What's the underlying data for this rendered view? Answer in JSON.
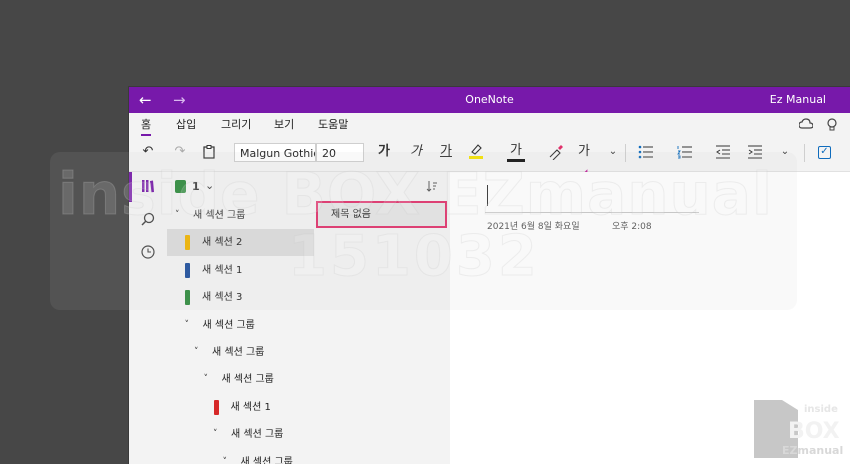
{
  "window": {
    "app_title": "OneNote",
    "user_name": "Ez Manual",
    "back_icon": "arrow-left-icon",
    "forward_icon": "arrow-right-icon"
  },
  "ribbon": {
    "tabs": [
      "홈",
      "삽입",
      "그리기",
      "보기",
      "도움말"
    ],
    "active_tab": "홈",
    "font_name": "Malgun Gothic",
    "font_size": "20",
    "bold_label": "가",
    "italic_label": "가",
    "underline_label": "가",
    "highlight_label": "가",
    "font_color_label": "가",
    "clear_format_label": "가",
    "tool_icons": [
      "undo-icon",
      "redo-icon",
      "clipboard-icon",
      "highlighter-icon",
      "format-painter-icon",
      "clear-formatting-icon",
      "bullets-icon",
      "numbering-icon",
      "outdent-icon",
      "indent-icon",
      "checkbox-icon"
    ],
    "accent_color": "#7719aa"
  },
  "notebook": {
    "name": "1",
    "icon_color": "#2e8b3d"
  },
  "sections": [
    {
      "label": "새 섹션 그룹",
      "type": "group",
      "indent": 0
    },
    {
      "label": "새 섹션 2",
      "type": "section",
      "color": "#f0b400",
      "indent": 0,
      "selected": true
    },
    {
      "label": "새 섹션 1",
      "type": "section",
      "color": "#1e4f9c",
      "indent": 0
    },
    {
      "label": "새 섹션 3",
      "type": "section",
      "color": "#2e8b3d",
      "indent": 0
    },
    {
      "label": "새 섹션 그룹",
      "type": "group",
      "indent": 1
    },
    {
      "label": "새 섹션 그룹",
      "type": "group",
      "indent": 2
    },
    {
      "label": "새 섹션 그룹",
      "type": "group",
      "indent": 3
    },
    {
      "label": "새 섹션 1",
      "type": "section",
      "color": "#d62828",
      "indent": 3
    },
    {
      "label": "새 섹션 그룹",
      "type": "group",
      "indent": 4
    },
    {
      "label": "새 섹션 그룹",
      "type": "group",
      "indent": 5
    }
  ],
  "pages": [
    {
      "title": "제목 없음",
      "selected": true
    }
  ],
  "page": {
    "date": "2021년 6월 8일 화요일",
    "time": "오후 2:08"
  },
  "watermark": {
    "line1": "inside BOX EZmanual",
    "line2": "151032"
  },
  "logo": {
    "line1": "inside",
    "line2": "BOX",
    "line3": "EZmanual"
  }
}
